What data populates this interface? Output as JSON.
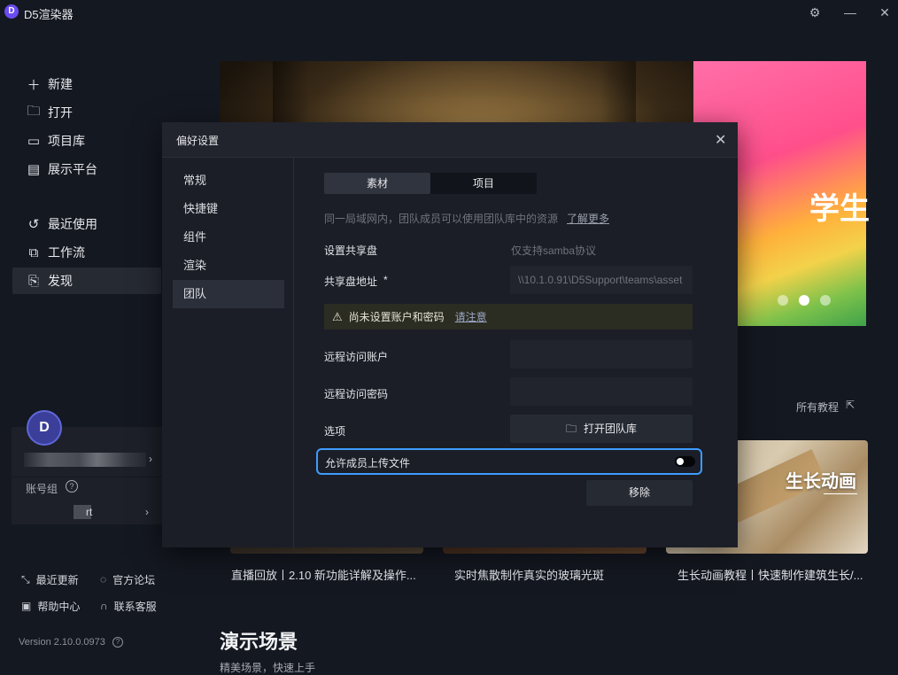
{
  "app": {
    "logo_letter": "D",
    "title": "D5渲染器"
  },
  "window": {
    "settings_icon": "gear-icon",
    "minimize": "—",
    "close": "✕"
  },
  "nav_top": [
    {
      "label": "新建",
      "icon": "plus-icon",
      "glyph": "＋"
    },
    {
      "label": "打开",
      "icon": "folder-icon",
      "glyph": "🗀"
    },
    {
      "label": "项目库",
      "icon": "library-icon",
      "glyph": "▭"
    },
    {
      "label": "展示平台",
      "icon": "display-icon",
      "glyph": "▤"
    }
  ],
  "nav_mid": [
    {
      "label": "最近使用",
      "icon": "history-icon",
      "glyph": "↺"
    },
    {
      "label": "工作流",
      "icon": "workflow-icon",
      "glyph": "⧉"
    },
    {
      "label": "发现",
      "icon": "discover-icon",
      "glyph": "⎘"
    }
  ],
  "account": {
    "avatar_letter": "D",
    "group_label": "账号组",
    "group_help": "?",
    "group_value": "rt",
    "chevron": "›"
  },
  "bottom_links": [
    {
      "label": "最近更新",
      "icon": "update-icon",
      "glyph": "⤡"
    },
    {
      "label": "官方论坛",
      "icon": "forum-icon",
      "glyph": "◌"
    },
    {
      "label": "帮助中心",
      "icon": "help-doc-icon",
      "glyph": "▣"
    },
    {
      "label": "联系客服",
      "icon": "headset-icon",
      "glyph": "∩"
    }
  ],
  "version": {
    "text": "Version 2.10.0.0973",
    "help": "?"
  },
  "hero": {
    "banner_text": "学生"
  },
  "tutorials": {
    "all_link": "所有教程",
    "link_icon": "external-link-icon"
  },
  "cards": [
    {
      "title": "直播回放丨2.10 新功能详解及操作..."
    },
    {
      "title": "实时焦散制作真实的玻璃光斑"
    },
    {
      "title": "生长动画教程丨快速制作建筑生长/...",
      "overlay": "生长动画"
    }
  ],
  "section": {
    "title": "演示场景",
    "subtitle": "精美场景，快速上手"
  },
  "modal": {
    "title": "偏好设置",
    "close": "✕",
    "sidebar": [
      "常规",
      "快捷键",
      "组件",
      "渲染",
      "团队"
    ],
    "active_sidebar": 4,
    "tabs": [
      "素材",
      "项目"
    ],
    "active_tab": 0,
    "intro": "同一局域网内，团队成员可以使用团队库中的资源",
    "learn_more": "了解更多",
    "share_disk_label": "设置共享盘",
    "share_disk_hint": "仅支持samba协议",
    "share_addr_label": "共享盘地址",
    "required": "*",
    "share_addr_value": "\\\\10.1.0.91\\D5Support\\teams\\asset",
    "warning_text": "尚未设置账户和密码",
    "warning_link": "请注意",
    "remote_account_label": "远程访问账户",
    "remote_password_label": "远程访问密码",
    "options_label": "选项",
    "open_library_button": "打开团队库",
    "allow_upload_label": "允许成员上传文件",
    "allow_upload_enabled": false,
    "remove_button": "移除"
  },
  "colors": {
    "accent": "#3e9bff",
    "logo": "#6b4cf0"
  }
}
